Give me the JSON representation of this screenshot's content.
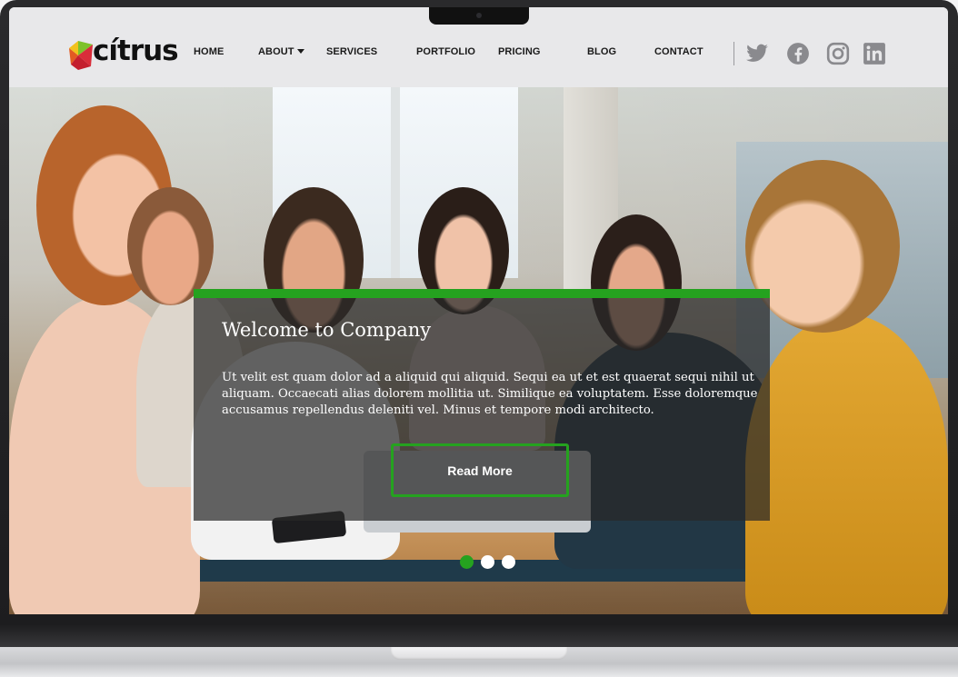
{
  "brand": {
    "name": "cítrus",
    "accent_color": "#25a21f"
  },
  "nav": {
    "items": [
      {
        "label": "HOME"
      },
      {
        "label": "ABOUT",
        "has_dropdown": true
      },
      {
        "label": "SERVICES"
      },
      {
        "label": "PORTFOLIO"
      },
      {
        "label": "PRICING"
      },
      {
        "label": "BLOG"
      },
      {
        "label": "CONTACT"
      }
    ]
  },
  "social": [
    "twitter-icon",
    "facebook-icon",
    "instagram-icon",
    "linkedin-icon"
  ],
  "hero": {
    "title": "Welcome to Company",
    "text": "Ut velit est quam dolor ad a aliquid qui aliquid. Sequi ea ut et est quaerat sequi nihil ut aliquam. Occaecati alias dolorem mollitia ut. Similique ea voluptatem. Esse doloremque accusamus repellendus deleniti vel. Minus et tempore modi architecto.",
    "button_label": "Read More",
    "slides_total": 3,
    "active_slide": 1
  }
}
